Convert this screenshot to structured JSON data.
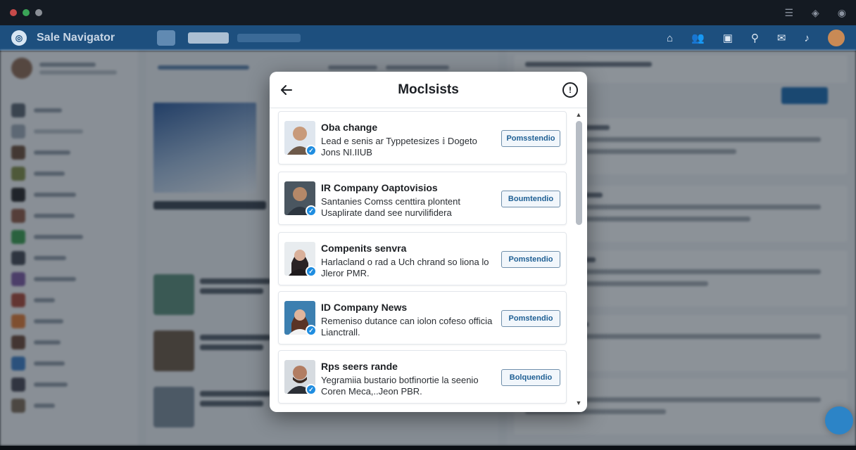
{
  "modal": {
    "title": "Moclsists",
    "items": [
      {
        "name": "Oba change",
        "desc": "Lead e senis ar Typpetesizes 𝕚 Dogeto Jons NI.IIUB",
        "action": "Pomsstendio",
        "photo_color": "#9c6f55"
      },
      {
        "name": "IR Company Oaptovisios",
        "desc": "Santanies Comss centtira plontent Usaplirate dand see nurvilifidera",
        "action": "Boumtendio",
        "photo_color": "#6b5a4e"
      },
      {
        "name": "Compenits senvra",
        "desc": "Harlacland o rad a Uch chrand so liona lo Jleror PMR.",
        "action": "Pomstendio",
        "photo_color": "#3d3638"
      },
      {
        "name": "ID Company News",
        "desc": "Remeniso dutance can iolon cofeso officia Lianctrall.",
        "action": "Pomstendio",
        "photo_color": "#7a4a3a"
      },
      {
        "name": "Rps seers rande",
        "desc": "Yegramiia bustario botfinortie la seenio Coren Meca,..Jeon PBR.",
        "action": "Bolquendio",
        "photo_color": "#5a4a42"
      }
    ]
  },
  "app": {
    "name": "Sale Navigator"
  },
  "colors": {
    "header": "#1d4f7e",
    "accent": "#1f8de0"
  }
}
